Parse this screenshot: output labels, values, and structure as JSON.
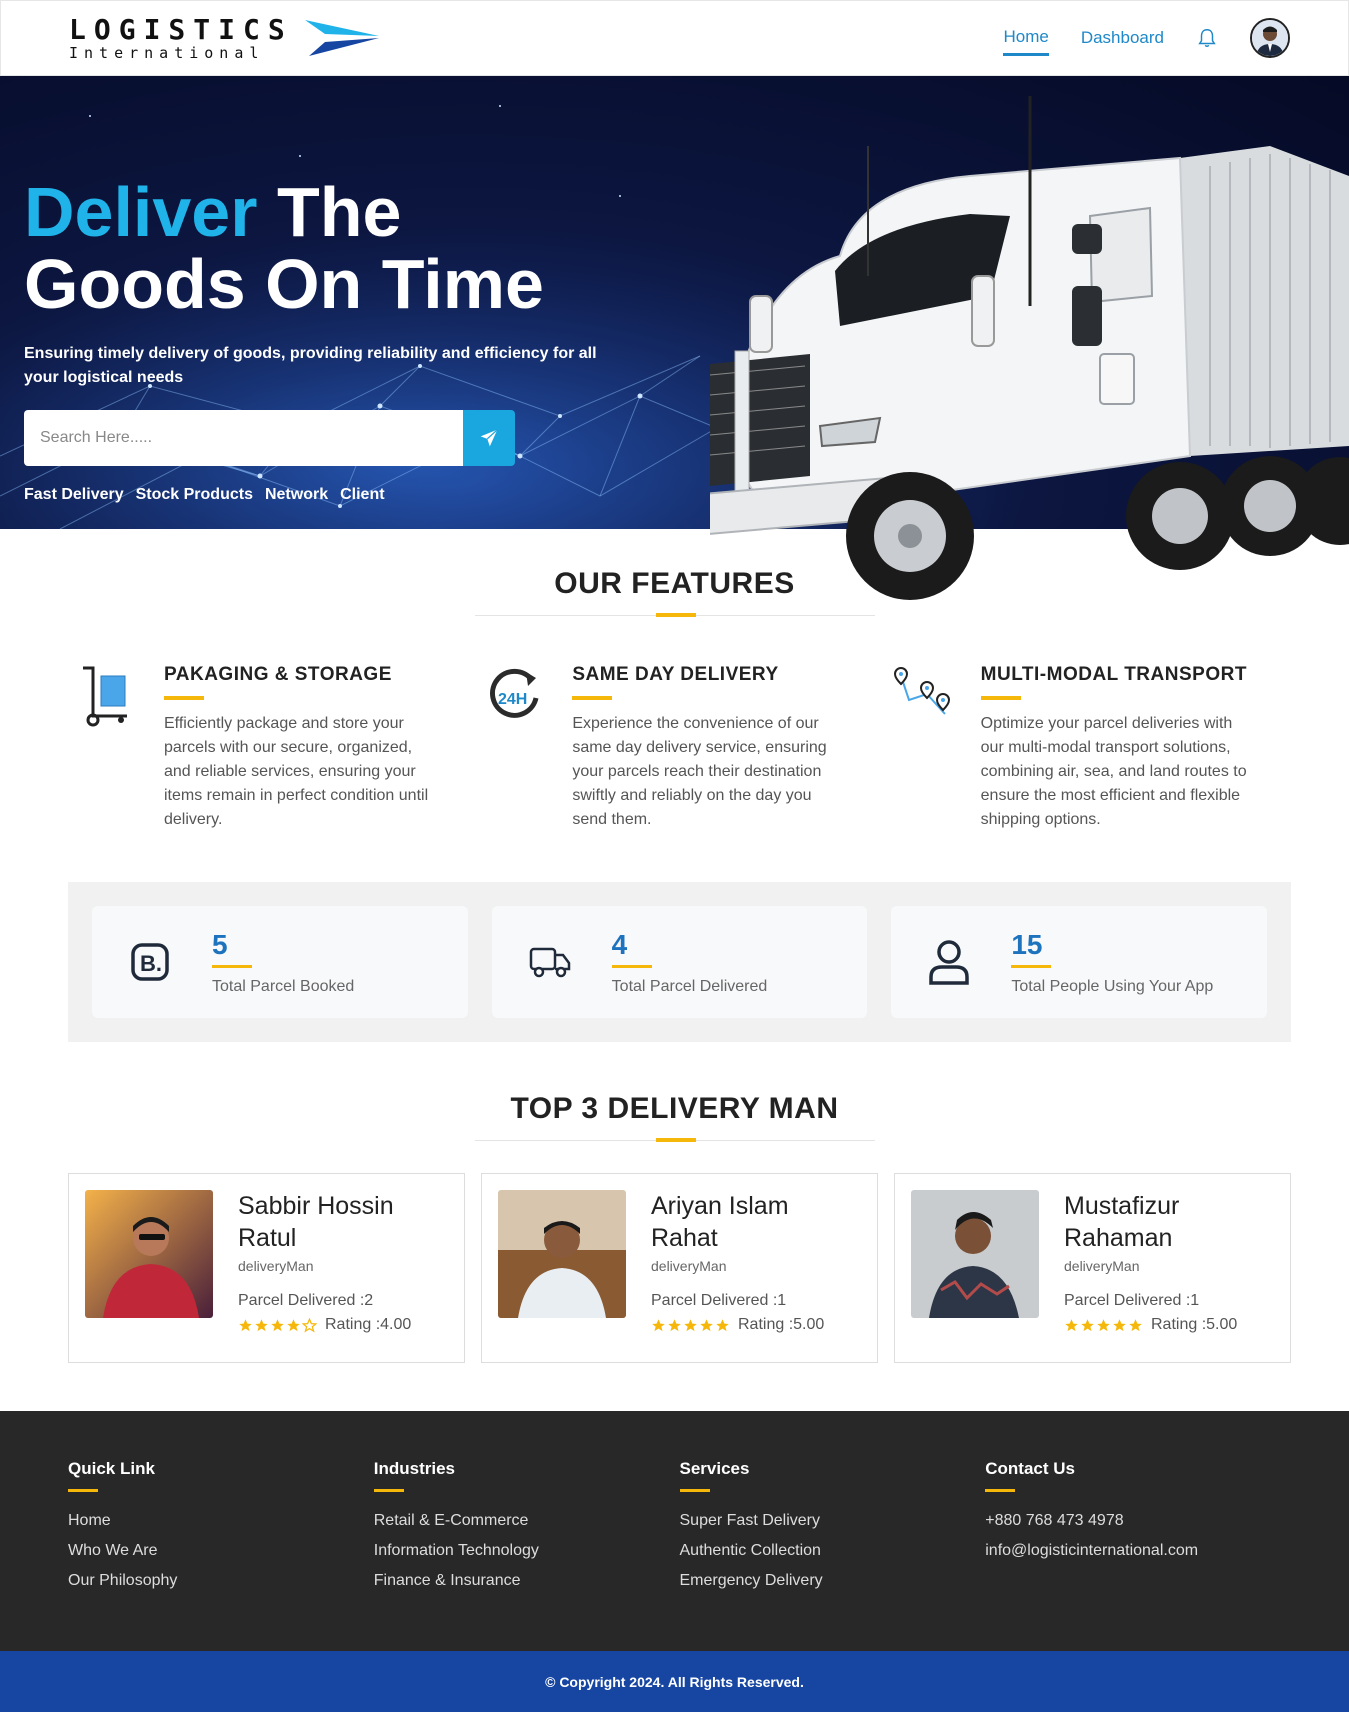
{
  "brand": {
    "name": "LOGISTICS",
    "tagline": "International"
  },
  "nav": {
    "home": "Home",
    "dashboard": "Dashboard"
  },
  "hero": {
    "title_accent": "Deliver",
    "title_rest": "The",
    "title_line2": "Goods On Time",
    "subtitle": "Ensuring timely delivery of goods, providing reliability and efficiency for all your logistical needs",
    "search_placeholder": "Search Here.....",
    "tags": [
      "Fast Delivery",
      "Stock Products",
      "Network",
      "Client"
    ]
  },
  "features": {
    "title_light": "OUR",
    "title_bold": "FEATURES",
    "items": [
      {
        "title": "PAKAGING & STORAGE",
        "icon": "hand-truck-box-icon",
        "desc": "Efficiently package and store your parcels with our secure, organized, and reliable services, ensuring your items remain in perfect condition until delivery."
      },
      {
        "title": "SAME DAY DELIVERY",
        "icon": "24h-clock-icon",
        "desc": "Experience the convenience of our same day delivery service, ensuring your parcels reach their destination swiftly and reliably on the day you send them."
      },
      {
        "title": "MULTI-MODAL TRANSPORT",
        "icon": "route-pins-icon",
        "desc": "Optimize your parcel deliveries with our multi-modal transport solutions, combining air, sea, and land routes to ensure the most efficient and flexible shipping options."
      }
    ]
  },
  "stats": [
    {
      "value": "5",
      "label": "Total Parcel Booked",
      "icon": "booking-b-icon"
    },
    {
      "value": "4",
      "label": "Total Parcel Delivered",
      "icon": "truck-icon"
    },
    {
      "value": "15",
      "label": "Total People Using Your App",
      "icon": "user-icon"
    }
  ],
  "delivery": {
    "title_light": "TOP 3",
    "title_bold": "DELIVERY MAN",
    "men": [
      {
        "name": "Sabbir Hossin Ratul",
        "role": "deliveryMan",
        "parcel": "Parcel Delivered :2",
        "rating": "Rating :4.00",
        "stars": 4
      },
      {
        "name": "Ariyan Islam Rahat",
        "role": "deliveryMan",
        "parcel": "Parcel Delivered :1",
        "rating": "Rating :5.00",
        "stars": 5
      },
      {
        "name": "Mustafizur Rahaman",
        "role": "deliveryMan",
        "parcel": "Parcel Delivered :1",
        "rating": "Rating :5.00",
        "stars": 5
      }
    ]
  },
  "footer": {
    "cols": [
      {
        "head": "Quick Link",
        "items": [
          "Home",
          "Who We Are",
          "Our Philosophy"
        ]
      },
      {
        "head": "Industries",
        "items": [
          "Retail & E-Commerce",
          "Information Technology",
          "Finance & Insurance"
        ]
      },
      {
        "head": "Services",
        "items": [
          "Super Fast Delivery",
          "Authentic Collection",
          "Emergency Delivery"
        ]
      },
      {
        "head": "Contact Us",
        "items": [
          "+880 768 473 4978",
          "info@logisticinternational.com"
        ]
      }
    ],
    "copyright": "© Copyright 2024. All Rights Reserved."
  },
  "colors": {
    "accent_blue": "#1fb3ea",
    "link_blue": "#1e88c8",
    "yellow": "#f5b70a",
    "footer_bg": "#282828",
    "copyright_bg": "#1746a2"
  }
}
